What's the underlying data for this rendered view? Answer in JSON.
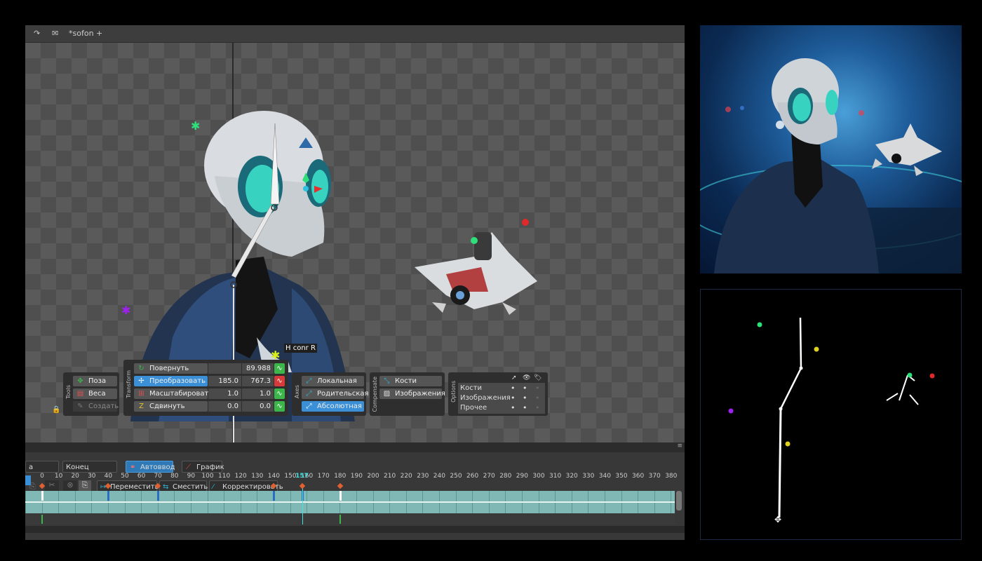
{
  "window": {
    "title": "*sofon +"
  },
  "viewport": {
    "bone_label": "H conr R"
  },
  "tools": {
    "title": "Tools",
    "pose": "Поза",
    "weights": "Веса",
    "create": "Создать"
  },
  "transform": {
    "title": "Transform",
    "rows": [
      {
        "label": "Повернуть",
        "v1": "",
        "v2": "89.988"
      },
      {
        "label": "Преобразовать",
        "v1": "185.0",
        "v2": "767.3"
      },
      {
        "label": "Масштабировать",
        "v1": "1.0",
        "v2": "1.0"
      },
      {
        "label": "Сдвинуть",
        "v1": "0.0",
        "v2": "0.0"
      }
    ]
  },
  "axes": {
    "title": "Axes",
    "local": "Локальная",
    "parent": "Родительская",
    "absolute": "Абсолютная"
  },
  "compensate": {
    "title": "Compensate",
    "bones": "Кости",
    "images": "Изображения"
  },
  "options": {
    "title": "Options",
    "rows": [
      "Кости",
      "Изображения",
      "Прочее"
    ]
  },
  "timeline": {
    "start_partial": "а",
    "end_label": "Конец",
    "autokey": "Автоввод",
    "graph": "График",
    "move": "Переместить",
    "offset": "Сместить",
    "adjust": "Корректировать",
    "current_frame": "157",
    "ruler": [
      "0",
      "10",
      "20",
      "30",
      "40",
      "50",
      "60",
      "70",
      "80",
      "90",
      "100",
      "110",
      "120",
      "130",
      "140",
      "150",
      "160",
      "170",
      "180",
      "190",
      "200",
      "210",
      "220",
      "230",
      "240",
      "250",
      "260",
      "270",
      "280",
      "290",
      "300",
      "310",
      "320",
      "330",
      "340",
      "350",
      "360",
      "370",
      "380"
    ]
  },
  "colors": {
    "accent": "#3a8fd6",
    "key_green": "#3cb54a",
    "key_red": "#d63a3a",
    "track": "#7fb8b4"
  }
}
